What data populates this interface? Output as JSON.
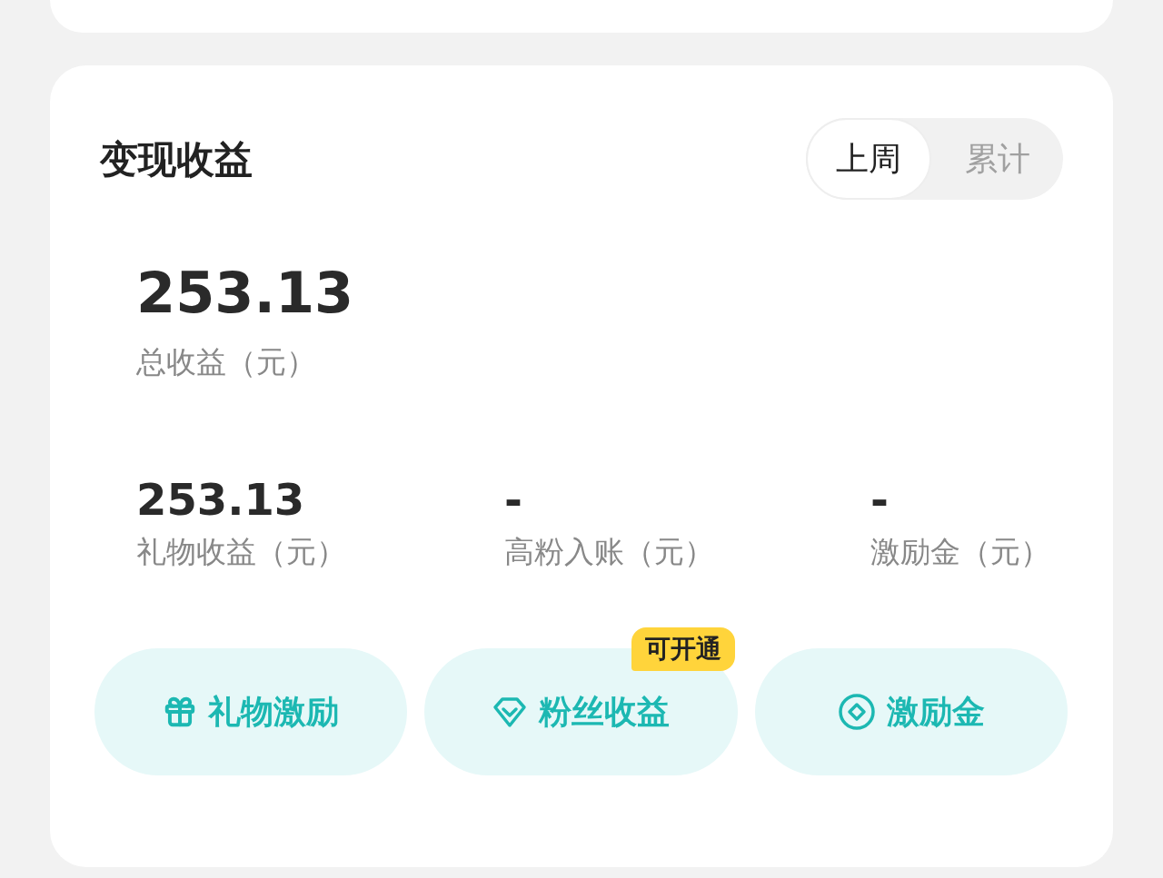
{
  "section": {
    "title": "变现收益",
    "period_tabs": [
      {
        "label": "上周",
        "selected": true
      },
      {
        "label": "累计",
        "selected": false
      }
    ],
    "total": {
      "value": "253.13",
      "label": "总收益（元）"
    },
    "metrics": [
      {
        "value": "253.13",
        "label": "礼物收益（元）"
      },
      {
        "value": "-",
        "label": "高粉入账（元）"
      },
      {
        "value": "-",
        "label": "激励金（元）"
      }
    ],
    "actions": [
      {
        "kind": "gift",
        "label": "礼物激励"
      },
      {
        "kind": "diamond",
        "label": "粉丝收益",
        "badge": "可开通"
      },
      {
        "kind": "coin",
        "label": "激励金"
      }
    ]
  }
}
